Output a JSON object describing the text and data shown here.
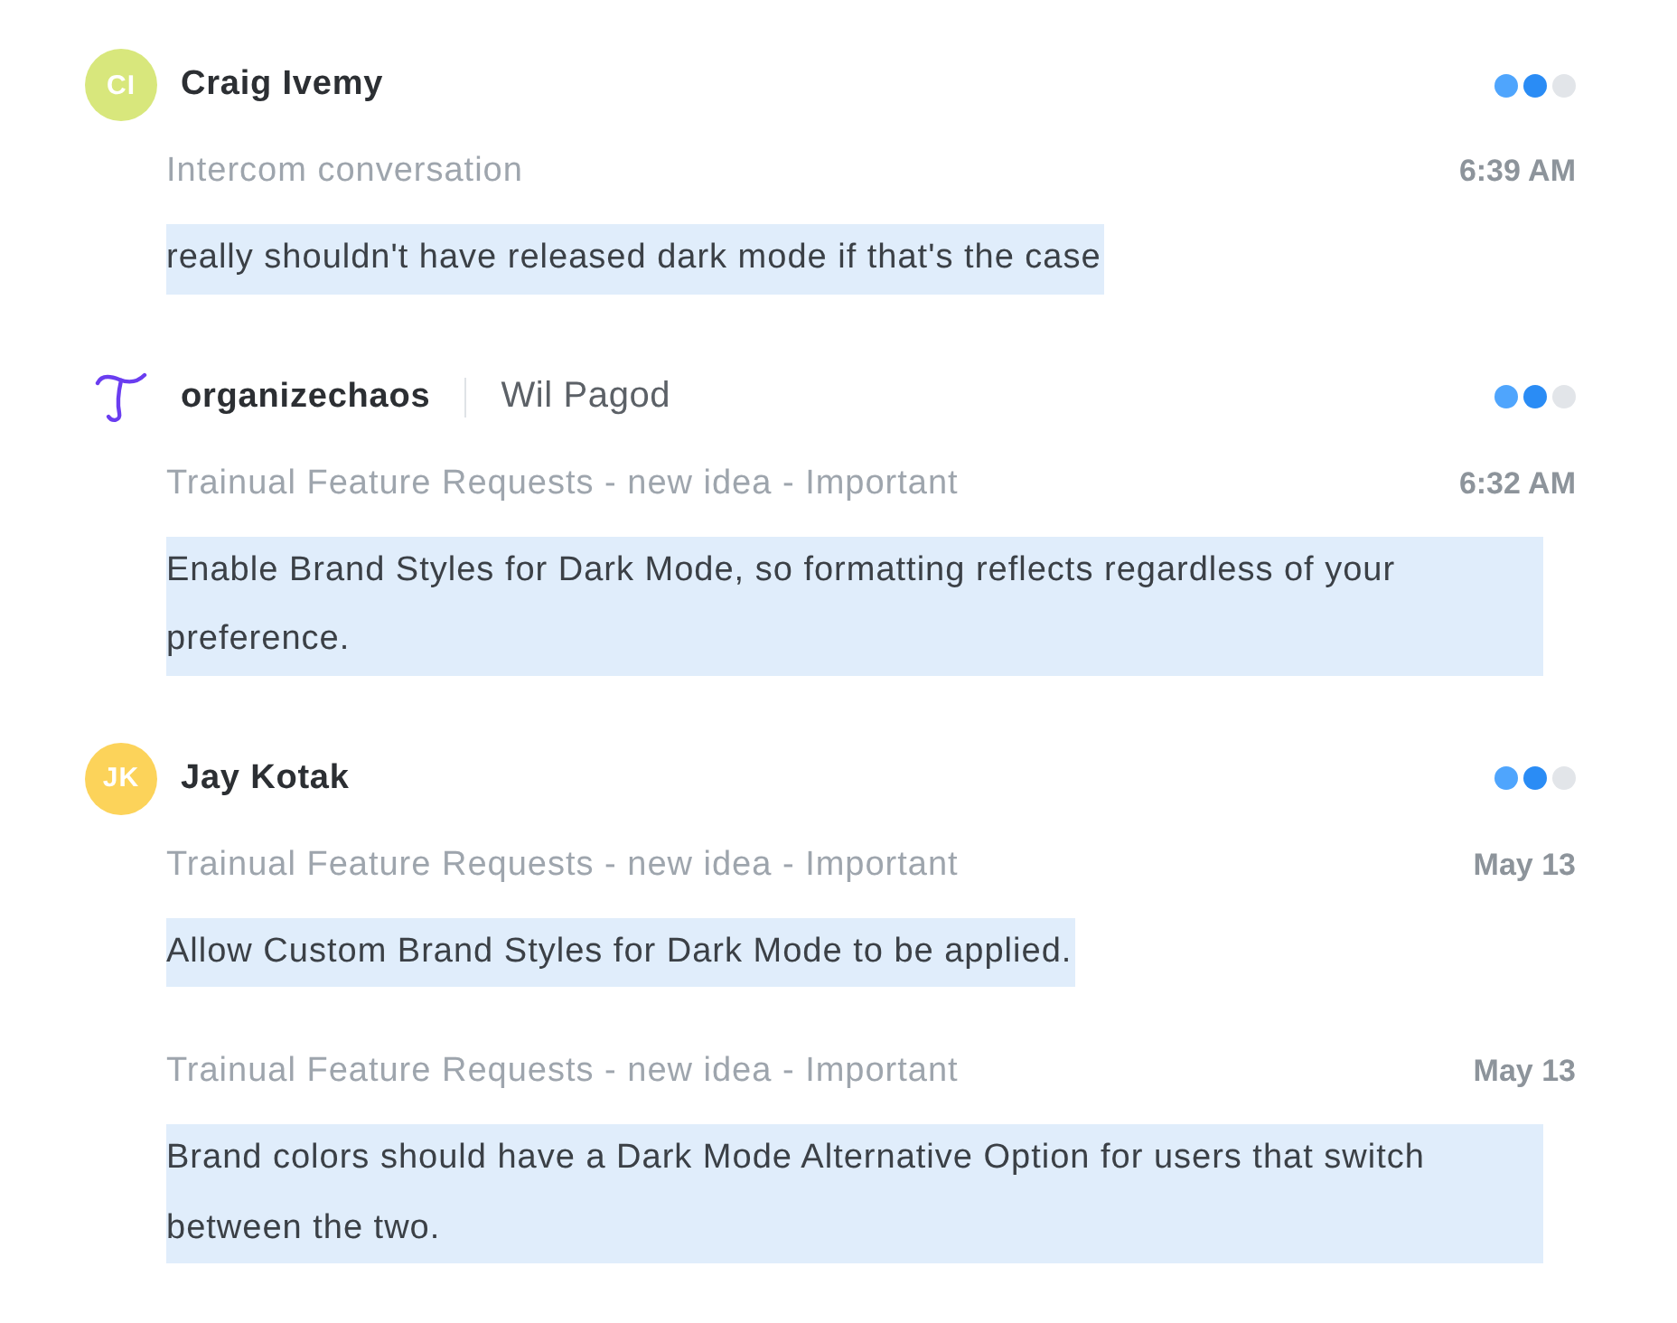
{
  "conversations": [
    {
      "avatar": {
        "kind": "initials",
        "initials": "CI",
        "color": "#d8e77c"
      },
      "name": "Craig Ivemy",
      "importance": [
        {
          "filled": true
        },
        {
          "filled": true
        },
        {
          "filled": false
        }
      ],
      "messages": [
        {
          "source": "Intercom conversation",
          "time": "6:39 AM",
          "text": "really shouldn't have released dark mode if that's the case"
        }
      ]
    },
    {
      "avatar": {
        "kind": "logo",
        "color": "#6a3df0"
      },
      "name": "organizechaos",
      "contact": "Wil Pagod",
      "importance": [
        {
          "filled": true
        },
        {
          "filled": true
        },
        {
          "filled": false
        }
      ],
      "messages": [
        {
          "source": "Trainual Feature Requests - new idea - Important",
          "time": "6:32 AM",
          "text": "Enable Brand Styles for Dark Mode, so formatting reflects regardless of your preference."
        }
      ]
    },
    {
      "avatar": {
        "kind": "initials",
        "initials": "JK",
        "color": "#fcd35a"
      },
      "name": "Jay Kotak",
      "importance": [
        {
          "filled": true
        },
        {
          "filled": true
        },
        {
          "filled": false
        }
      ],
      "messages": [
        {
          "source": "Trainual Feature Requests - new idea - Important",
          "time": "May 13",
          "text": "Allow Custom Brand Styles for Dark Mode to be applied."
        },
        {
          "source": "Trainual Feature Requests - new idea - Important",
          "time": "May 13",
          "text": "Brand colors should have a Dark Mode Alternative Option for users that switch between the two."
        }
      ]
    }
  ]
}
